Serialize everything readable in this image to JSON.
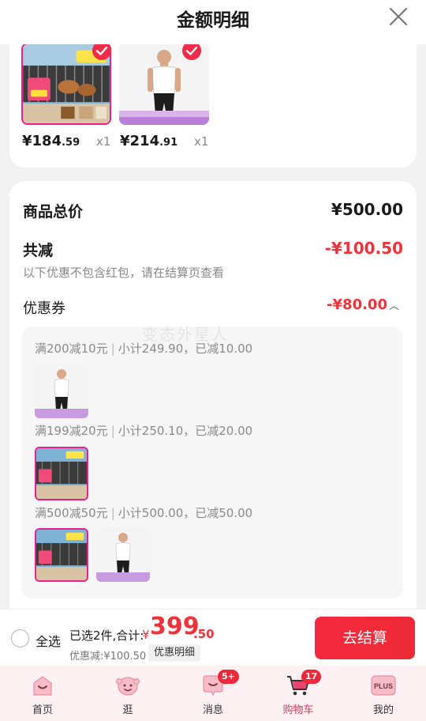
{
  "header": {
    "title": "金额明细"
  },
  "products": [
    {
      "price_int": "¥184",
      "price_dec": ".59",
      "qty": "x1",
      "checked": true
    },
    {
      "price_int": "¥214",
      "price_dec": ".91",
      "qty": "x1",
      "checked": true
    }
  ],
  "detail": {
    "total_label": "商品总价",
    "total_value": "¥500.00",
    "reduce_label": "共减",
    "reduce_value": "-¥100.50",
    "note": "以下优惠不包含红包，请在结算页查看",
    "coupon_label": "优惠券",
    "coupon_value": "-¥80.00",
    "tiers": [
      {
        "rule": "满200减10元",
        "summary": "小计249.90，已减10.00"
      },
      {
        "rule": "满199减20元",
        "summary": "小计250.10，已减20.00"
      },
      {
        "rule": "满500减50元",
        "summary": "小计500.00，已减50.00"
      }
    ]
  },
  "watermark": "变态外星人",
  "checkout": {
    "select_all": "全选",
    "summary": "已选2件,合计:",
    "currency": "¥",
    "total_int": "399",
    "total_dec": ".50",
    "discount_note": "优惠减:¥100.50",
    "detail_chip": "优惠明细",
    "go_button": "去结算"
  },
  "tabbar": {
    "items": [
      {
        "label": "首页",
        "icon": "home-icon"
      },
      {
        "label": "逛",
        "icon": "browse-icon"
      },
      {
        "label": "消息",
        "icon": "message-icon",
        "badge": "5+"
      },
      {
        "label": "购物车",
        "icon": "cart-icon",
        "badge": "17",
        "active": true
      },
      {
        "label": "我的",
        "icon": "plus-profile-icon",
        "icon_text": "PLUS"
      }
    ]
  },
  "colors": {
    "accent": "#f0323a",
    "active_tab": "#e8335c",
    "badge": "#f0283c"
  }
}
